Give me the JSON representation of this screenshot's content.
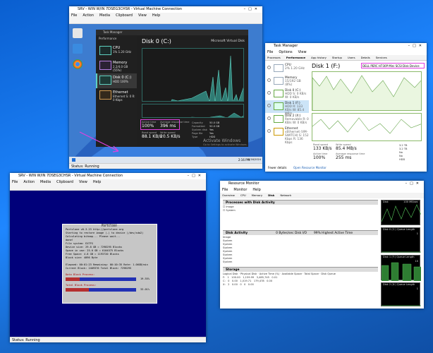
{
  "vm1": {
    "title": "SRV - WIN W/IN 7DSEG3CHSR - Virtual Machine Connection",
    "menu": [
      "File",
      "Action",
      "Media",
      "Clipboard",
      "View",
      "Help"
    ],
    "task_manager": {
      "title": "Task Manager",
      "section": "Performance",
      "sidebar": [
        {
          "name": "CPU",
          "sub": "1% 1.20 GHz"
        },
        {
          "name": "Memory",
          "sub": "2.2/4.0 GB (55%)"
        },
        {
          "name": "Disk 0 (C:)",
          "sub": "HDD\n100%"
        },
        {
          "name": "Ethernet",
          "sub": "Ethernet\nS: 0 R: 0 Kbps"
        }
      ],
      "disk_title": "Disk 0 (C:)",
      "disk_model": "Microsoft Virtual Disk",
      "active_time_label": "Active time",
      "avg_response_label": "Average response time",
      "active_time": "100%",
      "avg_response": "396 ms",
      "read_speed_label": "Read speed",
      "write_speed_label": "Write speed",
      "read_speed": "88.1 KB/s",
      "write_speed": "20.5 KB/s",
      "details": [
        "Capacity",
        "Formatted",
        "System disk",
        "Page file",
        "Type"
      ],
      "details_values": [
        "50.0 GB",
        "50.0 GB",
        "Yes",
        "Yes",
        "HDD"
      ],
      "activate": "Activate Windows",
      "activate_sub": "Go to Settings to activate Windows.",
      "clock": "2:16 PM",
      "date": "5/16/2024"
    },
    "status": "Status: Running"
  },
  "vm2": {
    "title": "Task Manager",
    "menu": [
      "File",
      "Options",
      "View"
    ],
    "tabs": [
      "Processes",
      "Performance",
      "App history",
      "Startup",
      "Users",
      "Details",
      "Services"
    ],
    "list": [
      {
        "name": "CPU",
        "sub": "2% 1.20 GHz"
      },
      {
        "name": "Memory",
        "sub": "15/192 GB (8%)"
      },
      {
        "name": "Disk 0 (C:)",
        "sub": "HDD\nS: 0 KB/s W: 0 KB/s"
      },
      {
        "name": "Disk 1 (F:)",
        "sub": "HDD\nR: 133 KB/s W: 85.4 MB/s"
      },
      {
        "name": "Disk 2 (X:)",
        "sub": "Removable\nR: 0 KB/s W: 0 KB/s"
      },
      {
        "name": "Ethernet",
        "sub": "vEthernet (VM-SWITCH)\nS: 152 Kbps R: 136 Kbps"
      }
    ],
    "disk_title": "Disk 1 (F:)",
    "disk_model": "DELL PERC H730P Mini SCSI Disk Device",
    "read_speed_label": "Read speed",
    "write_speed_label": "Write speed",
    "read_speed": "133 KB/s",
    "write_speed": "85.4 MB/s",
    "active_label": "Active time",
    "resp_label": "Average response time",
    "active_time": "100%",
    "avg_response": "255 ms",
    "details_values": [
      "3.2 TB",
      "3.2 TB",
      "No",
      "No",
      "HDD"
    ],
    "fewer": "Fewer details",
    "open_rm": "Open Resource Monitor"
  },
  "vm3": {
    "title": "SRV - WIN W/IN 7DSEG3CHSR - Virtual Machine Connection",
    "menu": [
      "File",
      "Action",
      "Media",
      "Clipboard",
      "View",
      "Help"
    ],
    "partclone": {
      "title": "Partclone",
      "lines": [
        "Partclone v0.3.23 http://partclone.org",
        "Starting to restore image (-) to device (/dev/sda2)",
        "Calculating bitmap... Please wait...",
        "done!",
        "File system:  EXTFS",
        "Device size:    29.8 GB = 7298295 Blocks",
        "Space in use:   25.0 GB = 6104575 Blocks",
        "Free Space:      4.8 GB = 1193720 Blocks",
        "Block size:   4096 Byte",
        "",
        "Elapsed: 00:01:23 Remaining: 00:10:35  Rate:  1.06GB/min",
        "Current Block: 2409376  Total Block: 7298295"
      ],
      "data_label": "Data Block Process:",
      "data_pct": "19.55%",
      "total_label": "Total Block Process:",
      "total_pct": "33.01%",
      "data_progress": 0.1955,
      "total_progress": 0.3301
    },
    "status": "Status: Running"
  },
  "vm4": {
    "title": "Resource Monitor",
    "menu": [
      "File",
      "Monitor",
      "Help"
    ],
    "tabs": [
      "Overview",
      "CPU",
      "Memory",
      "Disk",
      "Network"
    ],
    "proc_section": "Processes with Disk Activity",
    "disk_section": "Disk Activity",
    "disk_section_stat": "0 Bytes/sec Disk I/O",
    "disk_section_stat2": "99% Highest Active Time",
    "storage_section": "Storage",
    "storage_rows": [
      [
        "F:",
        "1",
        "100.00",
        "1,159.99",
        "3,485,745",
        "0.01"
      ],
      [
        "C:",
        "0",
        "0.00",
        "1,019.71",
        "179,478",
        "0.00"
      ],
      [
        "X:",
        "2",
        "0.00",
        "0",
        "0",
        "0.00"
      ]
    ],
    "graphs": [
      {
        "label": "Disk",
        "right": "100 MB/sec"
      },
      {
        "label": "Disk 0 (C:) Queue Length",
        "right": "1"
      },
      {
        "label": "Disk 1 (F:) Queue Length",
        "right": "10"
      },
      {
        "label": "Disk 2 (X:) Queue Length",
        "right": "1"
      }
    ]
  },
  "colors": {
    "accent": "#5fd0c0",
    "annotation": "#e040e0",
    "partclone_blue": "#00007a"
  }
}
